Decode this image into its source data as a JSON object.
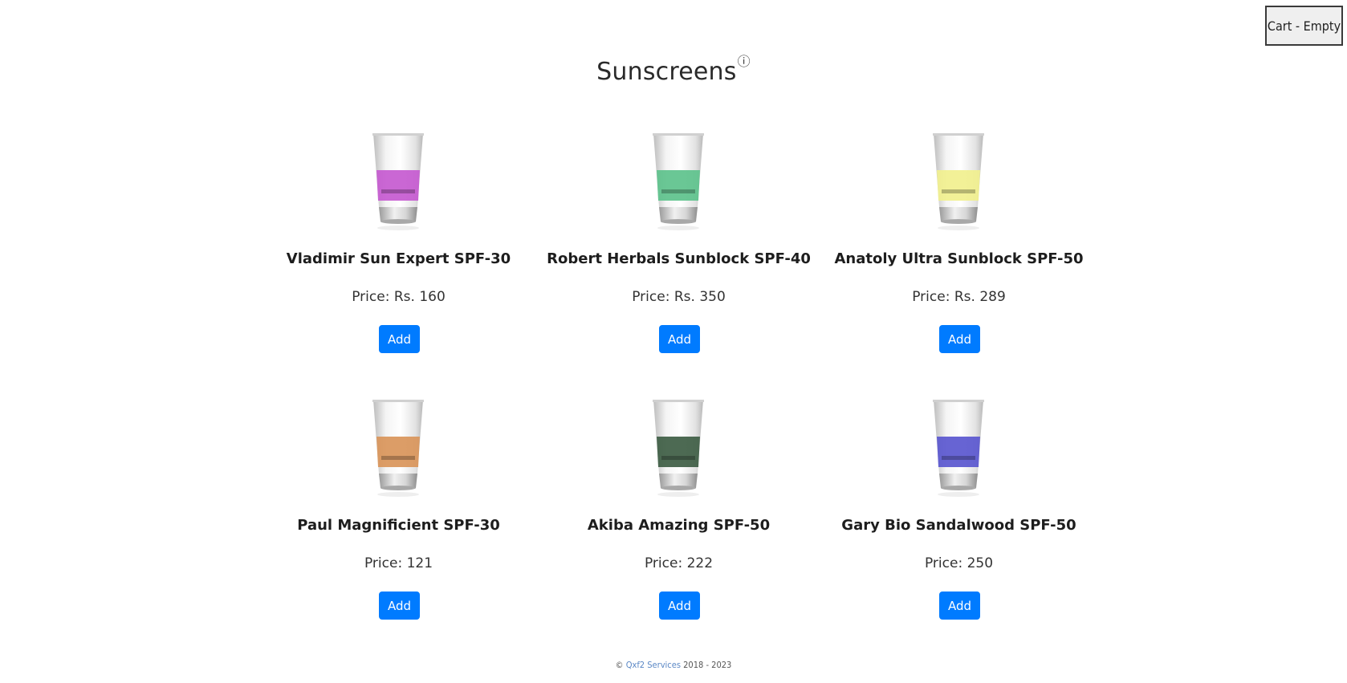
{
  "cart": {
    "label": "Cart - Empty"
  },
  "page": {
    "title": "Sunscreens",
    "info_symbol": "ⓘ"
  },
  "products": [
    {
      "name": "Vladimir Sun Expert SPF-30",
      "price": "Price: Rs. 160",
      "button": "Add",
      "label_color": "#c65ad0",
      "label_text": "Vladimir Sun",
      "label_sub": "Expert SPF-30"
    },
    {
      "name": "Robert Herbals Sunblock SPF-40",
      "price": "Price: Rs. 350",
      "button": "Add",
      "label_color": "#5dc28c",
      "label_text": "Robert Herbals",
      "label_sub": "Sunblock SPF-40"
    },
    {
      "name": "Anatoly Ultra Sunblock SPF-50",
      "price": "Price: Rs. 289",
      "button": "Add",
      "label_color": "#f1f08e",
      "label_text": "Anatoly Ultra",
      "label_sub": "Sunblock SPF-50"
    },
    {
      "name": "Paul Magnificient SPF-30",
      "price": "Price: 121",
      "button": "Add",
      "label_color": "#d9955a",
      "label_text": "Paul Magnificient",
      "label_sub": "SPF-30"
    },
    {
      "name": "Akiba Amazing SPF-50",
      "price": "Price: 222",
      "button": "Add",
      "label_color": "#3e5d44",
      "label_text": "Akiba Amazing",
      "label_sub": "SPF-50"
    },
    {
      "name": "Gary Bio Sandalwood SPF-50",
      "price": "Price: 250",
      "button": "Add",
      "label_color": "#5a57cf",
      "label_text": "Gary Bio",
      "label_sub": "Sandalwood SPF-50"
    }
  ],
  "footer": {
    "copyright": "©",
    "company": "Qxf2 Services",
    "years": "2018 - 2023"
  }
}
